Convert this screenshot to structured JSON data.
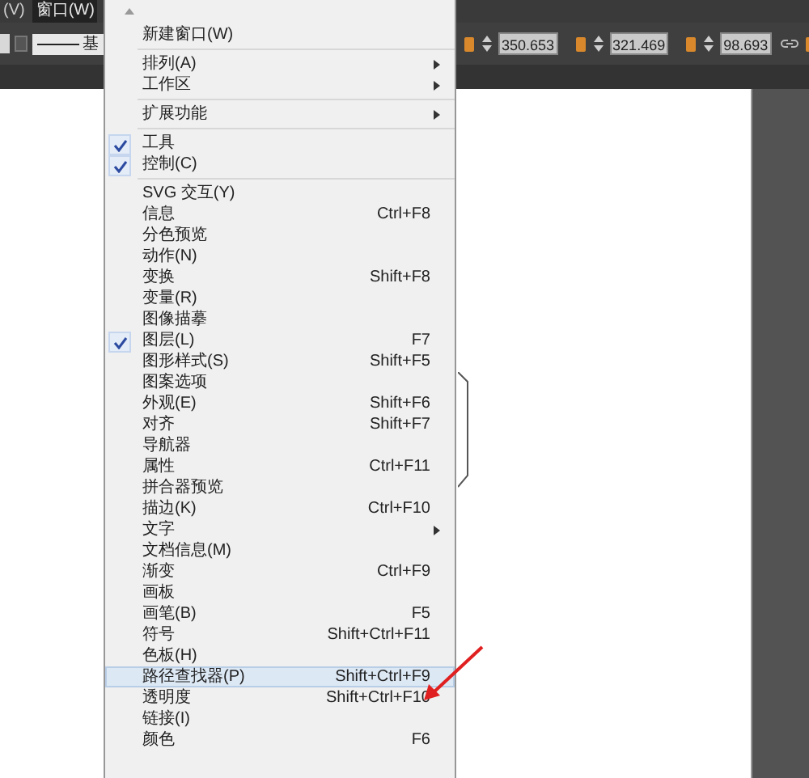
{
  "menu_bar": [
    {
      "label": "(V)",
      "selected": false
    },
    {
      "label": "窗口(W)",
      "selected": true
    }
  ],
  "control_bar": {
    "stroke_style": "基",
    "x_value": "350.653",
    "y_value": "321.469",
    "w_value": "98.693"
  },
  "menu": {
    "items": [
      {
        "kind": "item",
        "label": "新建窗口(W)",
        "checked": false,
        "submenu": false,
        "selected": false
      },
      {
        "kind": "separator"
      },
      {
        "kind": "item",
        "label": "排列(A)",
        "checked": false,
        "submenu": true,
        "selected": false
      },
      {
        "kind": "item",
        "label": "工作区",
        "checked": false,
        "submenu": true,
        "selected": false
      },
      {
        "kind": "separator"
      },
      {
        "kind": "item",
        "label": "扩展功能",
        "checked": false,
        "submenu": true,
        "selected": false
      },
      {
        "kind": "separator"
      },
      {
        "kind": "item",
        "label": "工具",
        "checked": true,
        "submenu": false,
        "selected": false
      },
      {
        "kind": "item",
        "label": "控制(C)",
        "checked": true,
        "submenu": false,
        "selected": false
      },
      {
        "kind": "separator"
      },
      {
        "kind": "item",
        "label": "SVG 交互(Y)",
        "checked": false,
        "submenu": false,
        "selected": false
      },
      {
        "kind": "item",
        "label": "信息",
        "shortcut": "Ctrl+F8",
        "checked": false,
        "submenu": false,
        "selected": false
      },
      {
        "kind": "item",
        "label": "分色预览",
        "checked": false,
        "submenu": false,
        "selected": false
      },
      {
        "kind": "item",
        "label": "动作(N)",
        "checked": false,
        "submenu": false,
        "selected": false
      },
      {
        "kind": "item",
        "label": "变换",
        "shortcut": "Shift+F8",
        "checked": false,
        "submenu": false,
        "selected": false
      },
      {
        "kind": "item",
        "label": "变量(R)",
        "checked": false,
        "submenu": false,
        "selected": false
      },
      {
        "kind": "item",
        "label": "图像描摹",
        "checked": false,
        "submenu": false,
        "selected": false
      },
      {
        "kind": "item",
        "label": "图层(L)",
        "shortcut": "F7",
        "checked": true,
        "submenu": false,
        "selected": false
      },
      {
        "kind": "item",
        "label": "图形样式(S)",
        "shortcut": "Shift+F5",
        "checked": false,
        "submenu": false,
        "selected": false
      },
      {
        "kind": "item",
        "label": "图案选项",
        "checked": false,
        "submenu": false,
        "selected": false
      },
      {
        "kind": "item",
        "label": "外观(E)",
        "shortcut": "Shift+F6",
        "checked": false,
        "submenu": false,
        "selected": false
      },
      {
        "kind": "item",
        "label": "对齐",
        "shortcut": "Shift+F7",
        "checked": false,
        "submenu": false,
        "selected": false
      },
      {
        "kind": "item",
        "label": "导航器",
        "checked": false,
        "submenu": false,
        "selected": false
      },
      {
        "kind": "item",
        "label": "属性",
        "shortcut": "Ctrl+F11",
        "checked": false,
        "submenu": false,
        "selected": false
      },
      {
        "kind": "item",
        "label": "拼合器预览",
        "checked": false,
        "submenu": false,
        "selected": false
      },
      {
        "kind": "item",
        "label": "描边(K)",
        "shortcut": "Ctrl+F10",
        "checked": false,
        "submenu": false,
        "selected": false
      },
      {
        "kind": "item",
        "label": "文字",
        "checked": false,
        "submenu": true,
        "selected": false
      },
      {
        "kind": "item",
        "label": "文档信息(M)",
        "checked": false,
        "submenu": false,
        "selected": false
      },
      {
        "kind": "item",
        "label": "渐变",
        "shortcut": "Ctrl+F9",
        "checked": false,
        "submenu": false,
        "selected": false
      },
      {
        "kind": "item",
        "label": "画板",
        "checked": false,
        "submenu": false,
        "selected": false
      },
      {
        "kind": "item",
        "label": "画笔(B)",
        "shortcut": "F5",
        "checked": false,
        "submenu": false,
        "selected": false
      },
      {
        "kind": "item",
        "label": "符号",
        "shortcut": "Shift+Ctrl+F11",
        "checked": false,
        "submenu": false,
        "selected": false
      },
      {
        "kind": "item",
        "label": "色板(H)",
        "checked": false,
        "submenu": false,
        "selected": false
      },
      {
        "kind": "item",
        "label": "路径查找器(P)",
        "shortcut": "Shift+Ctrl+F9",
        "checked": false,
        "submenu": false,
        "selected": true
      },
      {
        "kind": "item",
        "label": "透明度",
        "shortcut": "Shift+Ctrl+F10",
        "checked": false,
        "submenu": false,
        "selected": false
      },
      {
        "kind": "item",
        "label": "链接(I)",
        "checked": false,
        "submenu": false,
        "selected": false
      },
      {
        "kind": "item",
        "label": "颜色",
        "shortcut": "F6",
        "checked": false,
        "submenu": false,
        "selected": false
      }
    ]
  }
}
